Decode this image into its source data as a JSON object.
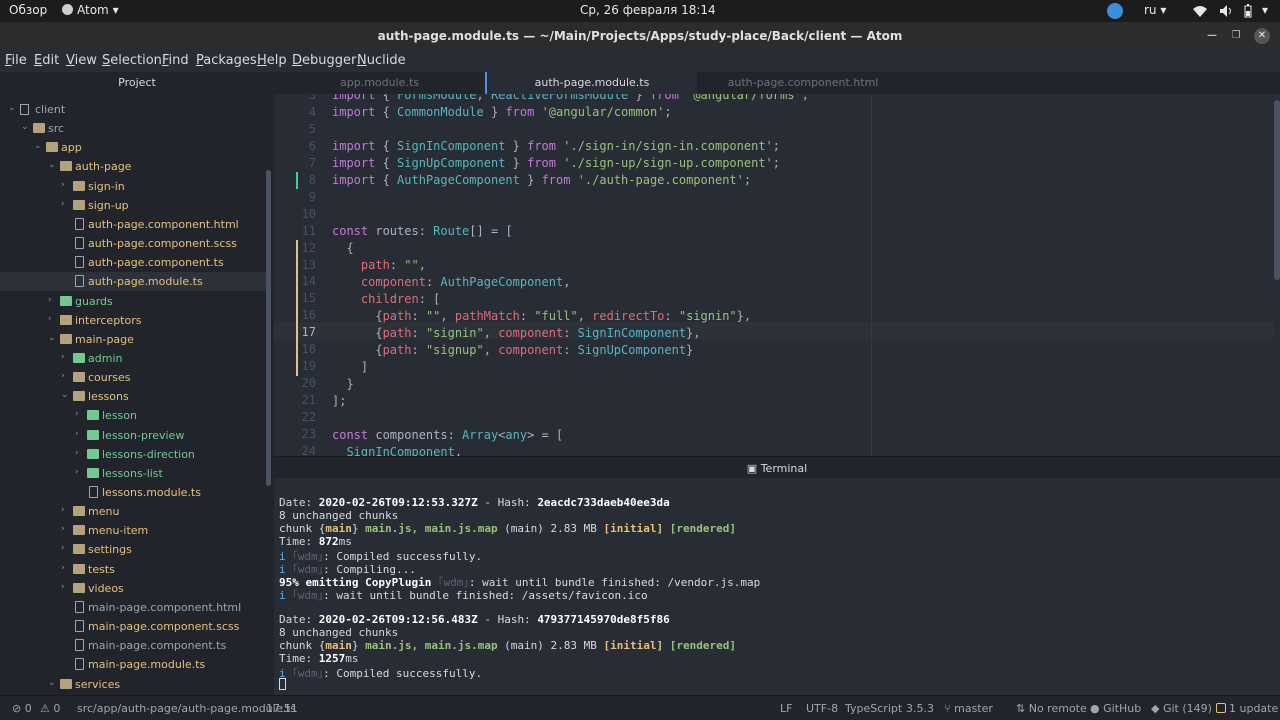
{
  "topbar": {
    "overview": "Обзор",
    "app_name": "Atom",
    "clock": "Ср, 26 февраля  18:14",
    "keyboard_layout": "ru"
  },
  "window": {
    "title": "auth-page.module.ts — ~/Main/Projects/Apps/study-place/Back/client — Atom"
  },
  "menu": [
    "File",
    "Edit",
    "View",
    "Selection",
    "Find",
    "Packages",
    "Help",
    "Debugger",
    "Nuclide"
  ],
  "tree": {
    "header": "Project",
    "rows": [
      {
        "label": "client",
        "type": "repo",
        "color": "plain"
      },
      {
        "label": "src",
        "type": "folder",
        "color": "plain"
      },
      {
        "label": "app",
        "type": "folder",
        "color": "yellow"
      },
      {
        "label": "auth-page",
        "type": "folder",
        "color": "yellow"
      },
      {
        "label": "sign-in",
        "type": "folder",
        "color": "yellow"
      },
      {
        "label": "sign-up",
        "type": "folder",
        "color": "yellow"
      },
      {
        "label": "auth-page.component.html",
        "type": "file",
        "color": "yellow"
      },
      {
        "label": "auth-page.component.scss",
        "type": "file",
        "color": "yellow"
      },
      {
        "label": "auth-page.component.ts",
        "type": "file",
        "color": "yellow"
      },
      {
        "label": "auth-page.module.ts",
        "type": "file",
        "color": "yellow"
      },
      {
        "label": "guards",
        "type": "folder",
        "color": "green"
      },
      {
        "label": "interceptors",
        "type": "folder",
        "color": "yellow"
      },
      {
        "label": "main-page",
        "type": "folder",
        "color": "yellow"
      },
      {
        "label": "admin",
        "type": "folder",
        "color": "green"
      },
      {
        "label": "courses",
        "type": "folder",
        "color": "yellow"
      },
      {
        "label": "lessons",
        "type": "folder",
        "color": "yellow"
      },
      {
        "label": "lesson",
        "type": "folder",
        "color": "green"
      },
      {
        "label": "lesson-preview",
        "type": "folder",
        "color": "green"
      },
      {
        "label": "lessons-direction",
        "type": "folder",
        "color": "green"
      },
      {
        "label": "lessons-list",
        "type": "folder",
        "color": "green"
      },
      {
        "label": "lessons.module.ts",
        "type": "file",
        "color": "yellow"
      },
      {
        "label": "menu",
        "type": "folder",
        "color": "yellow"
      },
      {
        "label": "menu-item",
        "type": "folder",
        "color": "yellow"
      },
      {
        "label": "settings",
        "type": "folder",
        "color": "yellow"
      },
      {
        "label": "tests",
        "type": "folder",
        "color": "yellow"
      },
      {
        "label": "videos",
        "type": "folder",
        "color": "yellow"
      },
      {
        "label": "main-page.component.html",
        "type": "file",
        "color": "plain"
      },
      {
        "label": "main-page.component.scss",
        "type": "file",
        "color": "yellow"
      },
      {
        "label": "main-page.component.ts",
        "type": "file",
        "color": "plain"
      },
      {
        "label": "main-page.module.ts",
        "type": "file",
        "color": "yellow"
      },
      {
        "label": "services",
        "type": "folder",
        "color": "yellow"
      }
    ]
  },
  "tabs": [
    "app.module.ts",
    "auth-page.module.ts",
    "auth-page.component.html"
  ],
  "editor": {
    "line_numbers": [
      "3",
      "4",
      "5",
      "6",
      "7",
      "8",
      "9",
      "10",
      "11",
      "12",
      "13",
      "14",
      "15",
      "16",
      "17",
      "18",
      "19",
      "20",
      "21",
      "22",
      "23",
      "24"
    ],
    "current_line": "17"
  },
  "terminal": {
    "title": "Terminal",
    "date1": "2020-02-26T09:12:53.327Z",
    "hash1": "2eacdc733daeb40ee3da",
    "unchanged1": "8 unchanged chunks",
    "size1": "2.83 MB",
    "time1": "872",
    "compiled_ok": "Compiled successfully.",
    "compiling": "Compiling...",
    "emitting": "95% emitting CopyPlugin",
    "wait_vendor": "wait until bundle finished: /vendor.js.map",
    "wait_favicon": "wait until bundle finished: /assets/favicon.ico",
    "date2": "2020-02-26T09:12:56.483Z",
    "hash2": "479377145970de8f5f86",
    "unchanged2": "8 unchanged chunks",
    "size2": "2.83 MB",
    "time2": "1257"
  },
  "status": {
    "errors": "0",
    "warnings": "0",
    "path": "src/app/auth-page/auth-page.module.ts",
    "cursor_pos": "17:51",
    "line_ending": "LF",
    "encoding": "UTF-8",
    "grammar": "TypeScript",
    "ts_version": "3.5.3",
    "branch": "master",
    "remote": "No remote",
    "github": "GitHub",
    "git": "Git (149)",
    "updates": "1 update"
  }
}
